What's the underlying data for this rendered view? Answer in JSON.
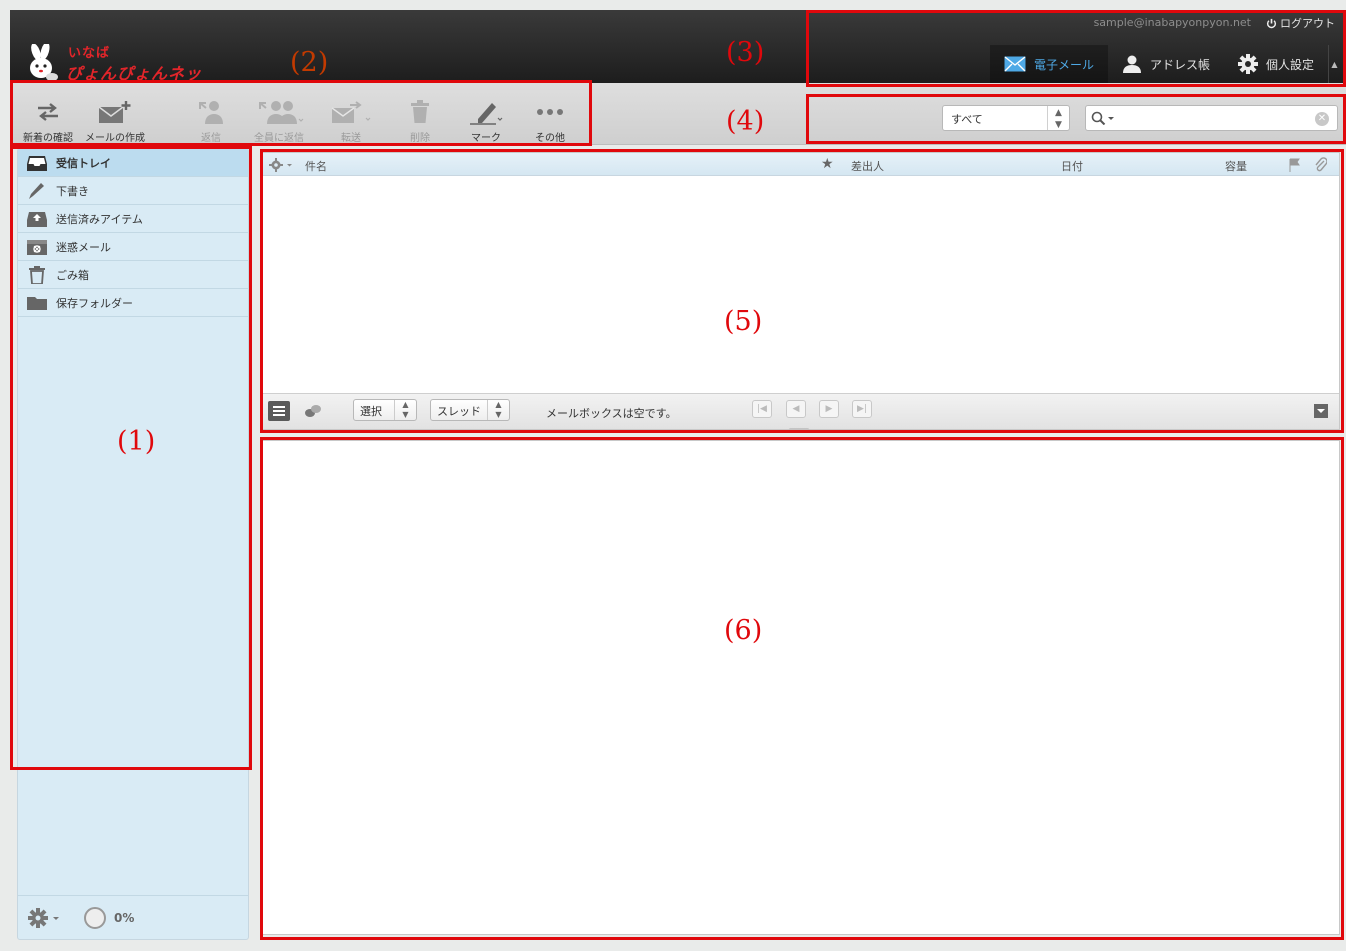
{
  "app": {
    "logo_line1": "いなば",
    "logo_line2": "ぴょんぴょんネット",
    "user_email": "sample@inabapyonpyon.net",
    "logout_label": "ログアウト",
    "nav": [
      {
        "label": "電子メール",
        "icon": "mail-icon",
        "active": true
      },
      {
        "label": "アドレス帳",
        "icon": "person-icon"
      },
      {
        "label": "個人設定",
        "icon": "gear-icon"
      }
    ]
  },
  "toolbar": {
    "items": [
      {
        "label": "新着の確認",
        "icon": "refresh-arrows-icon",
        "enabled": true
      },
      {
        "label": "メールの作成",
        "icon": "compose-icon",
        "enabled": true
      },
      {
        "label": "返信",
        "icon": "reply-icon",
        "enabled": false
      },
      {
        "label": "全員に返信",
        "icon": "reply-all-icon",
        "enabled": false
      },
      {
        "label": "転送",
        "icon": "forward-icon",
        "enabled": false
      },
      {
        "label": "削除",
        "icon": "trash-icon",
        "enabled": false
      },
      {
        "label": "マーク",
        "icon": "mark-pen-icon",
        "enabled": true
      },
      {
        "label": "その他",
        "icon": "more-icon",
        "enabled": true
      }
    ]
  },
  "search": {
    "filter_value": "すべて",
    "placeholder": ""
  },
  "sidebar": {
    "folders": [
      {
        "label": "受信トレイ",
        "icon": "inbox-icon",
        "selected": true
      },
      {
        "label": "下書き",
        "icon": "pencil-icon"
      },
      {
        "label": "送信済みアイテム",
        "icon": "sent-icon"
      },
      {
        "label": "迷惑メール",
        "icon": "junk-icon"
      },
      {
        "label": "ごみ箱",
        "icon": "trash-icon"
      },
      {
        "label": "保存フォルダー",
        "icon": "folder-icon"
      }
    ],
    "quota": "0%"
  },
  "messagelist": {
    "columns": [
      "件名",
      "差出人",
      "日付",
      "容量"
    ],
    "select_label": "選択",
    "thread_label": "スレッド",
    "status": "メールボックスは空です。"
  },
  "annotations": {
    "labels": [
      "(1)",
      "(2)",
      "(3)",
      "(4)",
      "(5)",
      "(6)"
    ],
    "color": "#e0080c"
  }
}
